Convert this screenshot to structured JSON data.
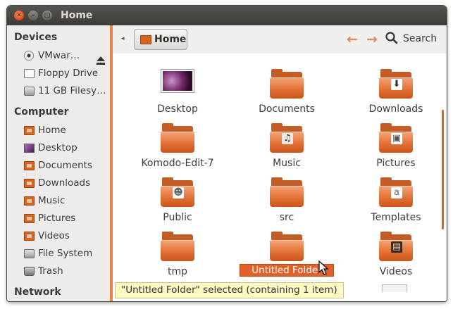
{
  "window": {
    "title": "Home"
  },
  "sidebar": {
    "sections": [
      {
        "header": "Devices",
        "items": [
          {
            "label": "VMwar…",
            "icon": "disc-icon"
          },
          {
            "label": "Floppy Drive",
            "icon": "floppy-icon"
          },
          {
            "label": "11 GB Filesy…",
            "icon": "drive-icon"
          }
        ]
      },
      {
        "header": "Computer",
        "items": [
          {
            "label": "Home",
            "icon": "home-folder-icon"
          },
          {
            "label": "Desktop",
            "icon": "desktop-icon"
          },
          {
            "label": "Documents",
            "icon": "documents-folder-icon"
          },
          {
            "label": "Downloads",
            "icon": "downloads-folder-icon"
          },
          {
            "label": "Music",
            "icon": "music-folder-icon"
          },
          {
            "label": "Pictures",
            "icon": "pictures-folder-icon"
          },
          {
            "label": "Videos",
            "icon": "videos-folder-icon"
          },
          {
            "label": "File System",
            "icon": "filesystem-icon"
          },
          {
            "label": "Trash",
            "icon": "trash-icon"
          }
        ]
      },
      {
        "header": "Network",
        "items": []
      }
    ]
  },
  "toolbar": {
    "path": "Home",
    "search_label": "Search"
  },
  "files": [
    {
      "name": "Desktop",
      "emblem": ""
    },
    {
      "name": "Documents",
      "emblem": ""
    },
    {
      "name": "Downloads",
      "emblem": "⬇"
    },
    {
      "name": "Komodo-Edit-7",
      "emblem": ""
    },
    {
      "name": "Music",
      "emblem": "♫"
    },
    {
      "name": "Pictures",
      "emblem": "▣"
    },
    {
      "name": "Public",
      "emblem": "☻"
    },
    {
      "name": "src",
      "emblem": ""
    },
    {
      "name": "Templates",
      "emblem": "a"
    },
    {
      "name": "tmp",
      "emblem": ""
    },
    {
      "name": "Untitled Folder",
      "emblem": ""
    },
    {
      "name": "Videos",
      "emblem": "▤"
    }
  ],
  "status": "\"Untitled Folder\" selected (containing 1 item)",
  "colors": {
    "accent": "#e0622a",
    "titlebar": "#3c3b37"
  }
}
